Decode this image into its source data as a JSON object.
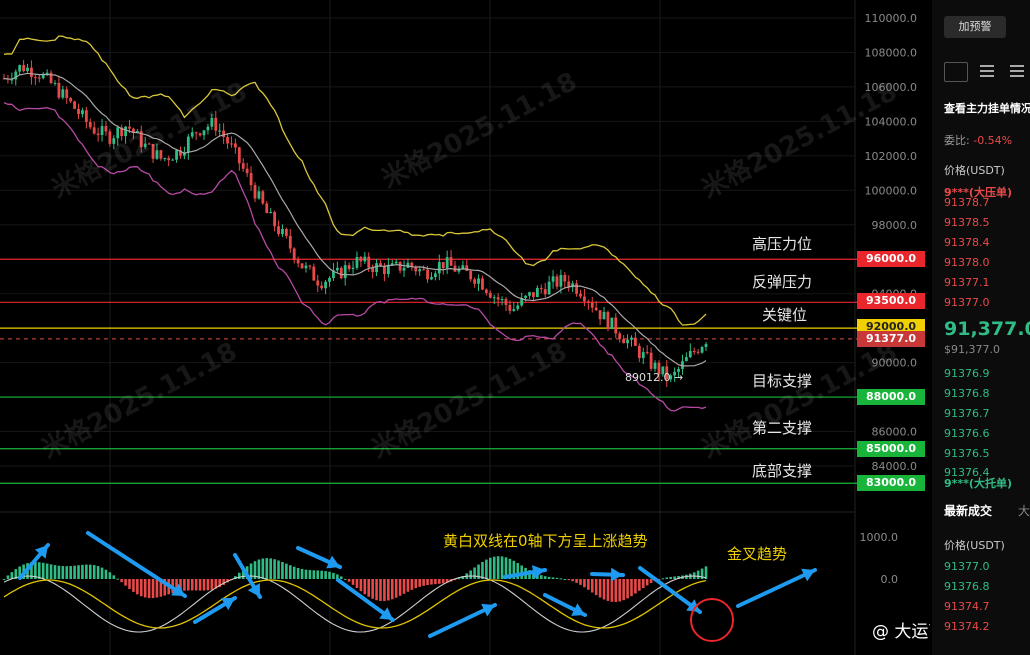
{
  "yaxis": {
    "labels": [
      "110000.0",
      "108000.0",
      "106000.0",
      "104000.0",
      "102000.0",
      "100000.0",
      "98000.0",
      "96000.0",
      "94000.0",
      "92000.0",
      "90000.0",
      "88000.0",
      "86000.0",
      "84000.0"
    ],
    "macd_labels": [
      "1000.0",
      "0.0"
    ]
  },
  "levels": [
    {
      "label": "高压力位",
      "price": "96000.0",
      "tag_color": "#e8262c"
    },
    {
      "label": "反弹压力",
      "price": "93500.0",
      "tag_color": "#e8262c"
    },
    {
      "label": "关键位",
      "price": "92000.0",
      "tag_color": "#f0d000"
    },
    {
      "label": "目标支撑",
      "price": "88000.0",
      "tag_color": "#19b43a"
    },
    {
      "label": "第二支撑",
      "price": "85000.0",
      "tag_color": "#19b43a"
    },
    {
      "label": "底部支撑",
      "price": "83000.0",
      "tag_color": "#19b43a"
    }
  ],
  "current_price_tag": "91377.0",
  "low_marker": "89012.0",
  "annotations": {
    "macd_note": "黄白双线在0轴下方呈上涨趋势",
    "golden_cross": "金叉趋势"
  },
  "watermark": "米格2025.11.18",
  "brand": "@ 大运亨通",
  "sidebar": {
    "alert_button": "加预警",
    "main_orders": "查看主力挂单情况",
    "ratio_label": "委比:",
    "ratio_value": "-0.54%",
    "price_header": "价格(USDT)",
    "ask_big": "9***(大压单)",
    "asks": [
      "91378.7",
      "91378.5",
      "91378.4",
      "91378.0",
      "91377.1",
      "91377.0"
    ],
    "last_price": "91,377.0",
    "last_price_usd": "$91,377.0",
    "bids": [
      "91376.9",
      "91376.8",
      "91376.7",
      "91376.6",
      "91376.5",
      "91376.4"
    ],
    "bid_big": "9***(大托单)",
    "trades_tab": "最新成交",
    "trades_tab2": "大",
    "trades_header": "价格(USDT)",
    "trades": [
      "91377.0",
      "91376.8",
      "91374.7",
      "91374.2"
    ]
  },
  "colors": {
    "up": "#2fbd85",
    "down": "#e84a4a",
    "boll_upper": "#d9c63a",
    "boll_mid": "#a9a9a9",
    "boll_lower": "#b54aa3",
    "arrow": "#1e9bf0"
  },
  "chart_data": {
    "type": "candlestick",
    "price_series_approx": [
      106500,
      107200,
      106800,
      105900,
      104800,
      103600,
      103100,
      103800,
      102600,
      101800,
      102300,
      103500,
      103900,
      102400,
      100500,
      98600,
      97200,
      95600,
      94700,
      95100,
      95900,
      95600,
      95400,
      95700,
      95200,
      95800,
      95300,
      94900,
      93800,
      93100,
      93900,
      94500,
      94800,
      94100,
      92800,
      91800,
      90800,
      89800,
      89012,
      90300,
      91377
    ],
    "support_resistance": [
      96000,
      93500,
      92000,
      88000,
      85000,
      83000
    ],
    "macd_axis": [
      "1000.0",
      "0.0"
    ]
  }
}
